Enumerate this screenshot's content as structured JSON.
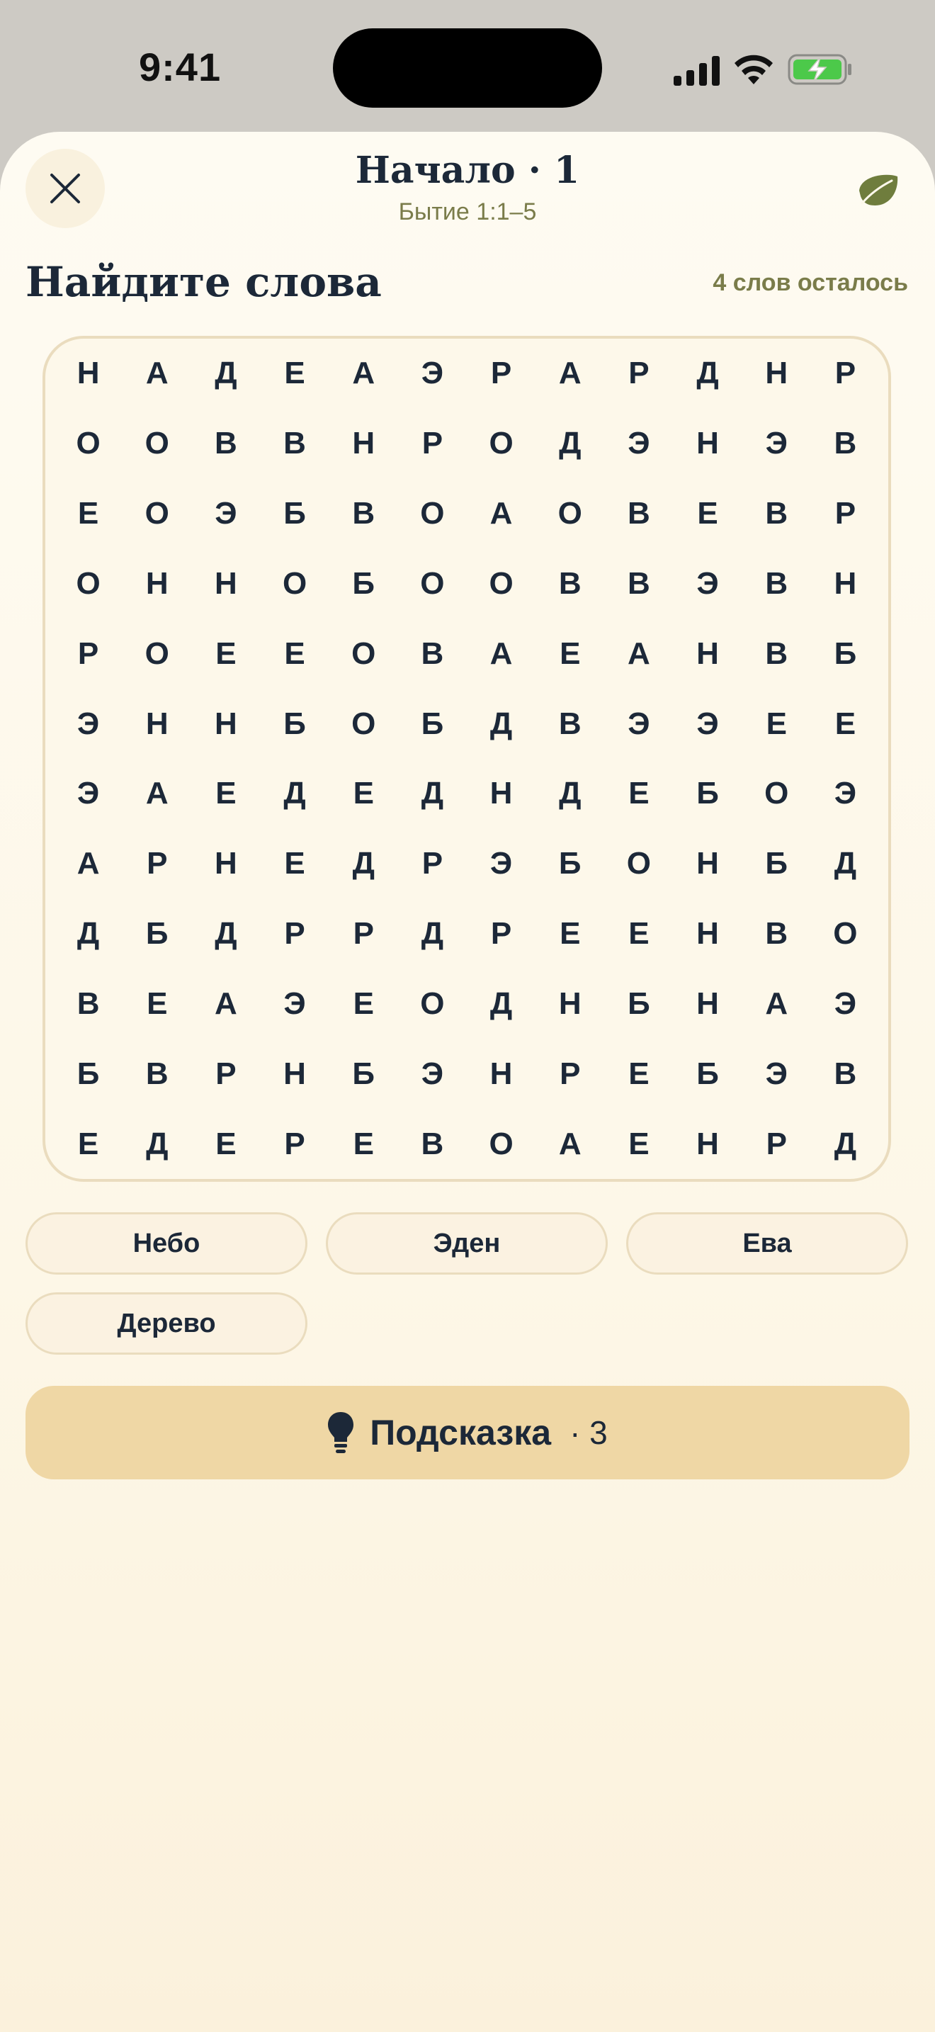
{
  "status_bar": {
    "time": "9:41"
  },
  "header": {
    "title": "Начало · 1",
    "subtitle": "Бытие 1:1–5"
  },
  "section": {
    "heading": "Найдите слова",
    "remaining": "4 слов осталось"
  },
  "grid": [
    [
      "Н",
      "А",
      "Д",
      "Е",
      "А",
      "Э",
      "Р",
      "А",
      "Р",
      "Д",
      "Н",
      "Р"
    ],
    [
      "О",
      "О",
      "В",
      "В",
      "Н",
      "Р",
      "О",
      "Д",
      "Э",
      "Н",
      "Э",
      "В"
    ],
    [
      "Е",
      "О",
      "Э",
      "Б",
      "В",
      "О",
      "А",
      "О",
      "В",
      "Е",
      "В",
      "Р"
    ],
    [
      "О",
      "Н",
      "Н",
      "О",
      "Б",
      "О",
      "О",
      "В",
      "В",
      "Э",
      "В",
      "Н"
    ],
    [
      "Р",
      "О",
      "Е",
      "Е",
      "О",
      "В",
      "А",
      "Е",
      "А",
      "Н",
      "В",
      "Б"
    ],
    [
      "Э",
      "Н",
      "Н",
      "Б",
      "О",
      "Б",
      "Д",
      "В",
      "Э",
      "Э",
      "Е",
      "Е"
    ],
    [
      "Э",
      "А",
      "Е",
      "Д",
      "Е",
      "Д",
      "Н",
      "Д",
      "Е",
      "Б",
      "О",
      "Э"
    ],
    [
      "А",
      "Р",
      "Н",
      "Е",
      "Д",
      "Р",
      "Э",
      "Б",
      "О",
      "Н",
      "Б",
      "Д"
    ],
    [
      "Д",
      "Б",
      "Д",
      "Р",
      "Р",
      "Д",
      "Р",
      "Е",
      "Е",
      "Н",
      "В",
      "О"
    ],
    [
      "В",
      "Е",
      "А",
      "Э",
      "Е",
      "О",
      "Д",
      "Н",
      "Б",
      "Н",
      "А",
      "Э"
    ],
    [
      "Б",
      "В",
      "Р",
      "Н",
      "Б",
      "Э",
      "Н",
      "Р",
      "Е",
      "Б",
      "Э",
      "В"
    ],
    [
      "Е",
      "Д",
      "Е",
      "Р",
      "Е",
      "В",
      "О",
      "А",
      "Е",
      "Н",
      "Р",
      "Д"
    ]
  ],
  "words": [
    "Небо",
    "Эден",
    "Ева",
    "Дерево"
  ],
  "hint": {
    "label": "Подсказка",
    "count": "· 3"
  },
  "colors": {
    "ink": "#1c2838",
    "olive": "#7a7c4a",
    "hint_bg": "#efd7a5",
    "chip_bg": "#fbf2e1",
    "battery_green": "#4cc94a"
  },
  "icons": {
    "close": "close-icon",
    "leaf": "leaf-icon",
    "hint": "lightbulb-icon",
    "signal": "cellular-signal-icon",
    "wifi": "wifi-icon",
    "battery": "battery-charging-icon"
  }
}
